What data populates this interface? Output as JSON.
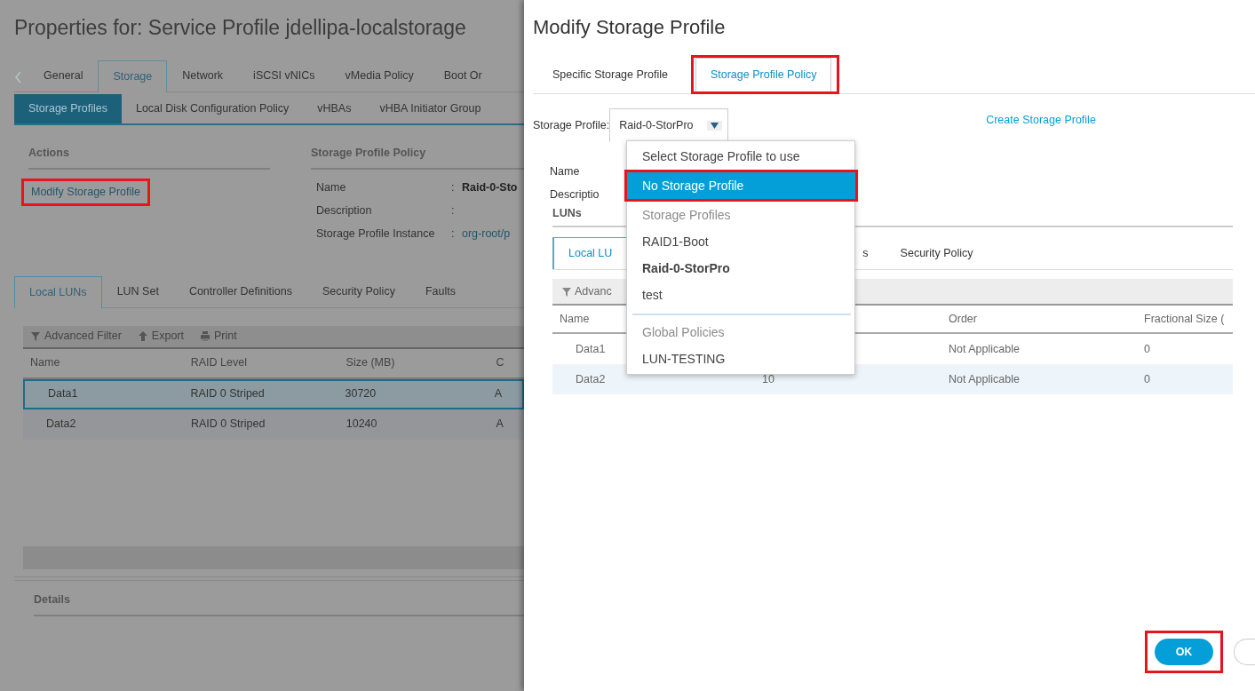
{
  "background_window": {
    "title": "Properties for: Service Profile jdellipa-localstorage",
    "tabs": [
      {
        "label": "General",
        "selected": false
      },
      {
        "label": "Storage",
        "selected": true
      },
      {
        "label": "Network",
        "selected": false
      },
      {
        "label": "iSCSI vNICs",
        "selected": false
      },
      {
        "label": "vMedia Policy",
        "selected": false
      },
      {
        "label": "Boot Or",
        "selected": false
      }
    ],
    "subtabs": [
      {
        "label": "Storage Profiles",
        "selected": true
      },
      {
        "label": "Local Disk Configuration Policy",
        "selected": false
      },
      {
        "label": "vHBAs",
        "selected": false
      },
      {
        "label": "vHBA Initiator Group",
        "selected": false
      }
    ],
    "actions": {
      "heading": "Actions",
      "links": [
        {
          "label": "Modify Storage Profile",
          "highlighted": true
        }
      ]
    },
    "policy": {
      "heading": "Storage Profile Policy",
      "fields": [
        {
          "label": "Name",
          "separator": ":",
          "value": "Raid-0-Sto",
          "kind": "bold"
        },
        {
          "label": "Description",
          "separator": ":"
        },
        {
          "label": "Storage Profile Instance",
          "separator": ":",
          "value": "org-root/p",
          "kind": "link"
        }
      ]
    },
    "lun_tabs": [
      {
        "label": "Local LUNs",
        "selected": true
      },
      {
        "label": "LUN Set",
        "selected": false
      },
      {
        "label": "Controller Definitions",
        "selected": false
      },
      {
        "label": "Security Policy",
        "selected": false
      },
      {
        "label": "Faults",
        "selected": false
      }
    ],
    "toolbar": [
      "Advanced Filter",
      "Export",
      "Print"
    ],
    "table": {
      "columns": [
        "Name",
        "RAID Level",
        "Size (MB)",
        "C"
      ],
      "rows": [
        {
          "cells": [
            "Data1",
            "RAID 0 Striped",
            "30720",
            "A"
          ],
          "selected": true
        },
        {
          "cells": [
            "Data2",
            "RAID 0 Striped",
            "10240",
            "A"
          ],
          "selected": false
        }
      ]
    },
    "details": {
      "heading": "Details"
    }
  },
  "dialog": {
    "title": "Modify Storage Profile",
    "tabs": [
      {
        "label": "Specific Storage Profile",
        "selected": false,
        "highlighted": false
      },
      {
        "label": "Storage Profile Policy",
        "selected": true,
        "highlighted": true
      }
    ],
    "storage_profile": {
      "label": "Storage Profile:",
      "value": "Raid-0-StorPro",
      "expanded": true
    },
    "create_link": "Create Storage Profile",
    "fields": [
      "Name",
      "Descriptio"
    ],
    "luns_heading": "LUNs",
    "lun_tabs": [
      {
        "label": "Local LU",
        "selected": true
      },
      {
        "label": "s",
        "selected": false
      },
      {
        "label": "Security Policy",
        "selected": false
      }
    ],
    "toolbar": [
      "Advanc"
    ],
    "table": {
      "columns": [
        "Name",
        "",
        "Order",
        "Fractional Size ("
      ],
      "rows": [
        {
          "cells": [
            "Data1",
            "",
            "Not Applicable",
            "0"
          ]
        },
        {
          "cells": [
            "Data2",
            "10",
            "Not Applicable",
            "0"
          ]
        }
      ]
    },
    "dropdown": [
      {
        "kind": "prompt",
        "label": "Select Storage Profile to use",
        "selected": false,
        "highlighted": false
      },
      {
        "kind": "option",
        "label": "No Storage Profile",
        "selected": true,
        "highlighted": true
      },
      {
        "kind": "group",
        "label": "Storage Profiles",
        "selected": false,
        "highlighted": false
      },
      {
        "kind": "option",
        "label": "RAID1-Boot",
        "selected": false,
        "highlighted": false
      },
      {
        "kind": "current",
        "label": "Raid-0-StorPro",
        "selected": false,
        "highlighted": false
      },
      {
        "kind": "option",
        "label": "test",
        "selected": false,
        "highlighted": false
      },
      {
        "kind": "divider"
      },
      {
        "kind": "group",
        "label": "Global Policies",
        "selected": false,
        "highlighted": false
      },
      {
        "kind": "option",
        "label": "LUN-TESTING",
        "selected": false,
        "highlighted": false
      }
    ],
    "ok_button": {
      "label": "OK",
      "highlighted": true
    }
  }
}
